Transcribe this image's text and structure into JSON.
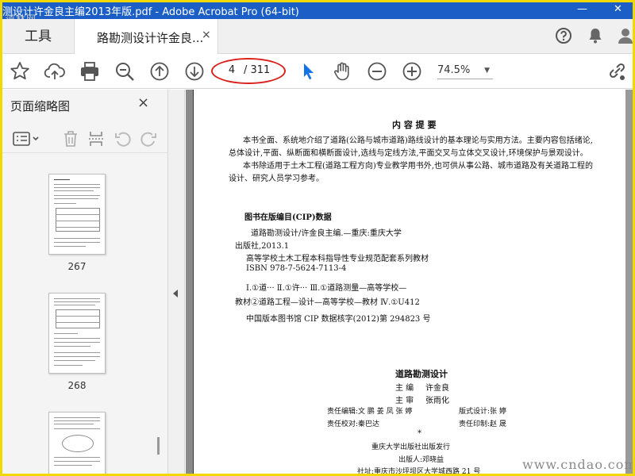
{
  "window": {
    "title": "测设计许金良主编2013年版.pdf - Adobe Acrobat Pro (64-bit)",
    "watermark": "道林网"
  },
  "tabs": {
    "tools_label": "工具",
    "doc_label": "路勘测设计许金良...",
    "close_glyph": "×"
  },
  "toolbar": {
    "page_current": "4",
    "page_total": "/ 311",
    "zoom": "74.5%"
  },
  "thumbnails_panel": {
    "title": "页面缩略图",
    "close_glyph": "×",
    "pages": [
      {
        "label": "267"
      },
      {
        "label": "268"
      }
    ]
  },
  "document": {
    "summary_title": "内 容 提 要",
    "summary_p1_l1": "本书全面、系统地介绍了道路(公路与城市道路)路线设计的基本理论与实用方法。主要内容包括绪论,",
    "summary_p1_l2": "总体设计,平面、纵断面和横断面设计,选线与定线方法,平面交叉与立体交叉设计,环境保护与景观设计。",
    "summary_p2_l1": "本书除适用于土木工程(道路工程方向)专业教学用书外,也可供从事公路、城市道路及有关道路工程的",
    "summary_p2_l2": "设计、研究人员学习参考。",
    "cip_title": "图书在版编目(CIP)数据",
    "cip_l1": "道路勘测设计/许金良主编.—重庆:重庆大学",
    "cip_l2": "出版社,2013.1",
    "cip_l3": "高等学校土木工程本科指导性专业规范配套系列教材",
    "cip_l4": "ISBN 978-7-5624-7113-4",
    "cip_l5": "Ⅰ.①道···  Ⅱ.①许···  Ⅲ.①道路测量—高等学校—",
    "cip_l6": "教材②道路工程—设计—高等学校—教材  Ⅳ.①U412",
    "cip_l7": "中国版本图书馆 CIP 数据核字(2012)第 294823 号",
    "book_title": "道路勘测设计",
    "editor_label": "主  编",
    "editor_name": "许金良",
    "reviewer_label": "主  审",
    "reviewer_name": "张雨化",
    "staff_l1_left": "责任编辑:文  鹏  姜  凤  张  婷",
    "staff_l1_right": "版式设计:张  婷",
    "staff_l2_left": "责任校对:秦巴达",
    "staff_l2_right": "责任印制:赵  晟",
    "star": "*",
    "publisher": "重庆大学出版社出版发行",
    "publisher_person": "出版人:邓晓益",
    "address": "社址:重庆市沙坪坝区大学城西路 21 号"
  },
  "site_watermark": "www.cndao.com"
}
